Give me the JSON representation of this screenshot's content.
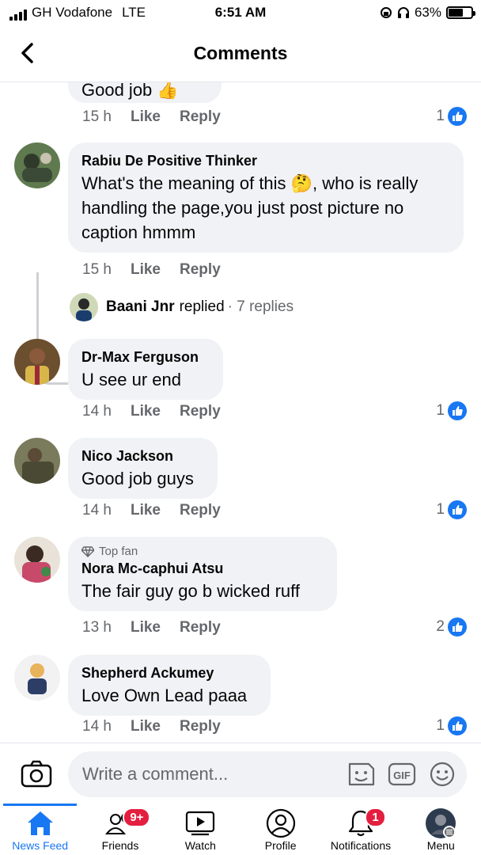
{
  "status_bar": {
    "carrier": "GH Vodafone",
    "network": "LTE",
    "time": "6:51 AM",
    "battery": "63%"
  },
  "header": {
    "title": "Comments"
  },
  "comments": [
    {
      "name": "",
      "text": "Good job 👍",
      "time": "15 h",
      "like_label": "Like",
      "reply_label": "Reply",
      "likes": "1"
    },
    {
      "name": "Rabiu De Positive Thinker",
      "text": "What's the meaning of this 🤔, who is really handling the page,you just post picture no caption hmmm",
      "time": "15 h",
      "like_label": "Like",
      "reply_label": "Reply",
      "likes": ""
    },
    {
      "name": "Dr-Max Ferguson",
      "text": "U see ur end",
      "time": "14 h",
      "like_label": "Like",
      "reply_label": "Reply",
      "likes": "1"
    },
    {
      "name": "Nico Jackson",
      "text": "Good job guys",
      "time": "14 h",
      "like_label": "Like",
      "reply_label": "Reply",
      "likes": "1"
    },
    {
      "badge": "Top fan",
      "name": "Nora Mc-caphui Atsu",
      "text": "The fair guy go b wicked ruff",
      "time": "13 h",
      "like_label": "Like",
      "reply_label": "Reply",
      "likes": "2"
    },
    {
      "name": "Shepherd Ackumey",
      "text": "Love Own Lead paaa",
      "time": "14 h",
      "like_label": "Like",
      "reply_label": "Reply",
      "likes": "1"
    }
  ],
  "reply_summary": {
    "name": "Baani Jnr",
    "action": "replied",
    "count": "· 7 replies"
  },
  "composer": {
    "placeholder": "Write a comment..."
  },
  "tabs": [
    {
      "label": "News Feed",
      "icon": "home-icon"
    },
    {
      "label": "Friends",
      "icon": "friends-icon",
      "badge": "9+"
    },
    {
      "label": "Watch",
      "icon": "watch-icon"
    },
    {
      "label": "Profile",
      "icon": "profile-icon"
    },
    {
      "label": "Notifications",
      "icon": "bell-icon",
      "badge": "1"
    },
    {
      "label": "Menu",
      "icon": "menu-avatar"
    }
  ],
  "colors": {
    "accent": "#1877f2",
    "bubble": "#f0f2f5",
    "muted": "#65676b",
    "badge": "#e41e3f"
  }
}
